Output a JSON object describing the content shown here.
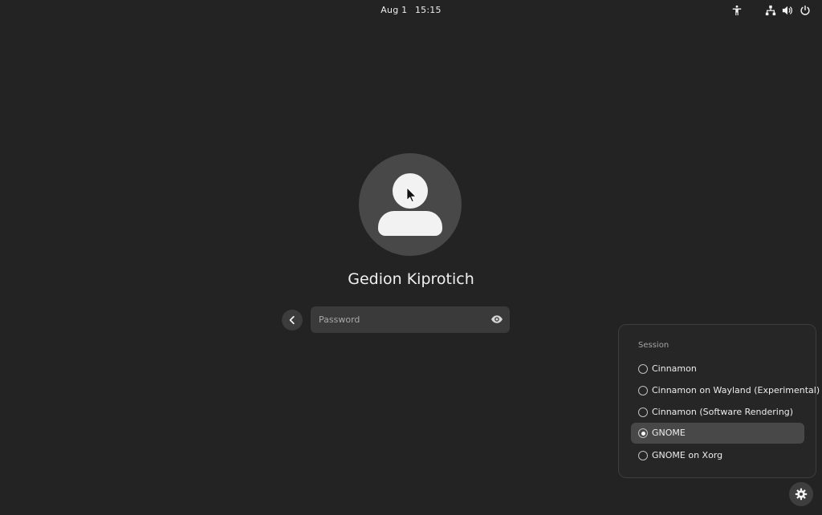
{
  "topbar": {
    "date": "Aug 1",
    "time": "15:15",
    "icons": [
      "accessibility-icon",
      "network-icon",
      "volume-icon",
      "power-icon"
    ]
  },
  "login": {
    "username": "Gedion Kiprotich",
    "password_placeholder": "Password",
    "password_value": ""
  },
  "session_menu": {
    "title": "Session",
    "items": [
      {
        "label": "Cinnamon",
        "selected": false
      },
      {
        "label": "Cinnamon on Wayland (Experimental)",
        "selected": false
      },
      {
        "label": "Cinnamon (Software Rendering)",
        "selected": false
      },
      {
        "label": "GNOME",
        "selected": true
      },
      {
        "label": "GNOME on Xorg",
        "selected": false
      }
    ]
  },
  "colors": {
    "background": "#232323",
    "avatar_circle": "#484848",
    "selected_item": "#484848",
    "text": "#ececec"
  }
}
